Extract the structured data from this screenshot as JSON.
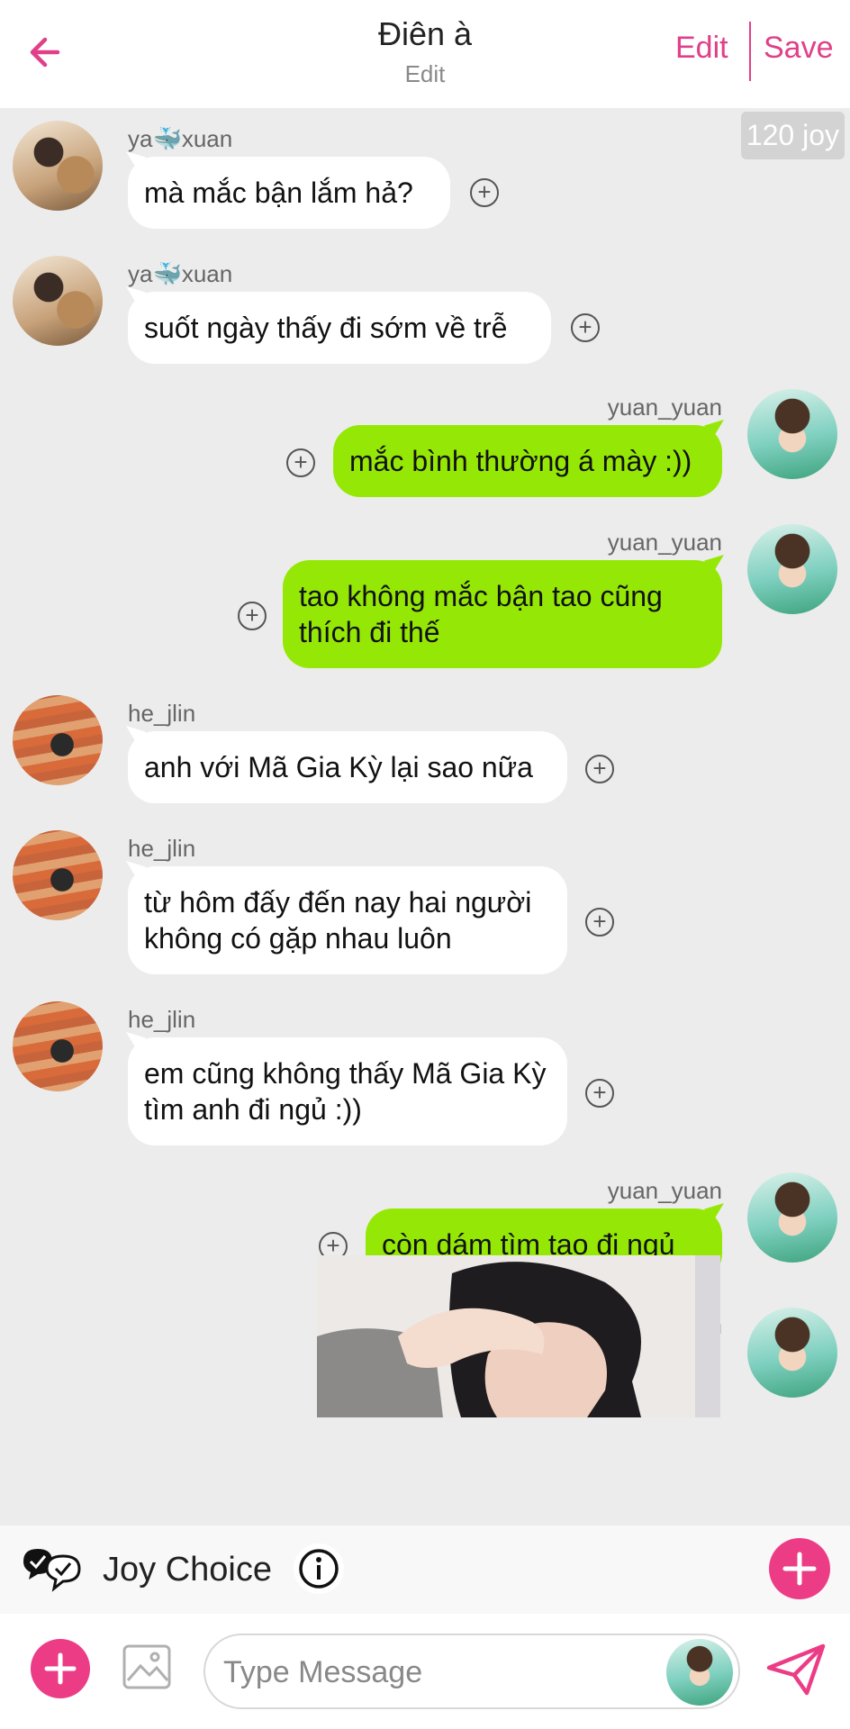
{
  "header": {
    "title": "Điên à",
    "subtitle": "Edit",
    "edit_label": "Edit",
    "save_label": "Save"
  },
  "joy_badge": "120 joy",
  "messages": [
    {
      "side": "left",
      "user": "ya🐳xuan",
      "text": "mà mắc bận lắm hả?"
    },
    {
      "side": "left",
      "user": "ya🐳xuan",
      "text": "suốt ngày thấy đi sớm về trễ"
    },
    {
      "side": "right",
      "user": "yuan_yuan",
      "text": "mắc bình thường á mày :))"
    },
    {
      "side": "right",
      "user": "yuan_yuan",
      "text": "tao không mắc bận tao cũng thích đi thế"
    },
    {
      "side": "left",
      "user": "he_jlin",
      "text": "anh với Mã Gia Kỳ lại sao nữa"
    },
    {
      "side": "left",
      "user": "he_jlin",
      "text": "từ hôm đấy đến nay hai người không có gặp nhau luôn"
    },
    {
      "side": "left",
      "user": "he_jlin",
      "text": "em cũng không thấy Mã Gia Kỳ tìm anh đi ngủ :))"
    },
    {
      "side": "right",
      "user": "yuan_yuan",
      "text": "còn dám tìm tao đi ngủ"
    },
    {
      "side": "right",
      "user": "yuan_yuan",
      "text": ""
    }
  ],
  "joy_choice": {
    "label": "Joy Choice"
  },
  "input": {
    "placeholder": "Type Message"
  },
  "colors": {
    "accent": "#ec3c86",
    "green_bubble": "#95e806",
    "header_text": "#e0408a"
  },
  "icons": [
    "back-arrow-icon",
    "add-circle-icon",
    "joy-choice-icon",
    "info-icon",
    "plus-icon",
    "image-icon",
    "send-icon"
  ]
}
